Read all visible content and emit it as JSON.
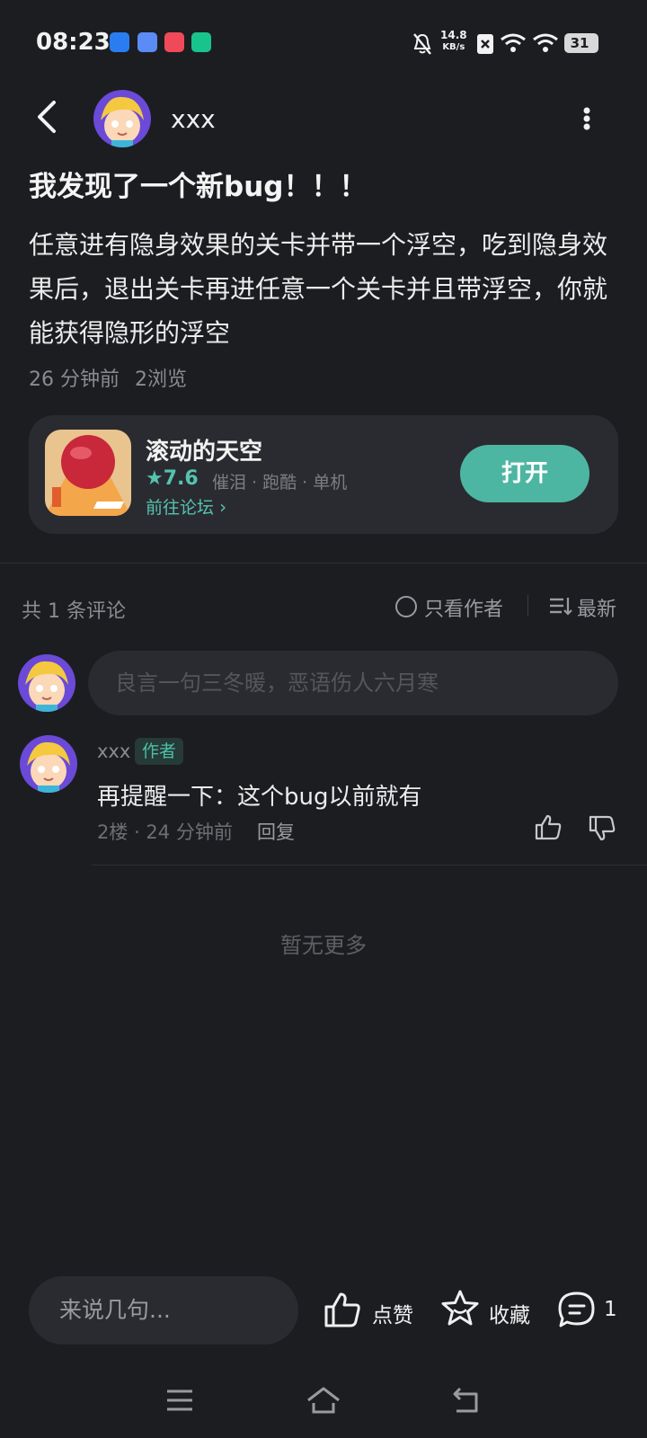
{
  "status_bar": {
    "time": "08:23",
    "speed_value": "14.8",
    "speed_unit": "KB/s",
    "battery": "31",
    "icons": [
      "mute-icon",
      "sim-off-icon",
      "wifi-icon",
      "wifi-icon",
      "battery-icon"
    ]
  },
  "header": {
    "username": "xxx"
  },
  "post": {
    "title": "我发现了一个新bug！！！",
    "body": "任意进有隐身效果的关卡并带一个浮空，吃到隐身效果后，退出关卡再进任意一个关卡并且带浮空，你就能获得隐形的浮空",
    "time": "26 分钟前",
    "views": "2浏览"
  },
  "game_card": {
    "name": "滚动的天空",
    "rating": "7.6",
    "tags": "催泪 · 跑酷 · 单机",
    "forum_link": "前往论坛",
    "open_label": "打开"
  },
  "comments_section": {
    "count_label": "共 1 条评论",
    "only_author_label": "只看作者",
    "sort_label": "最新",
    "input_placeholder": "良言一句三冬暖，恶语伤人六月寒"
  },
  "comments": [
    {
      "author": "xxx",
      "badge": "作者",
      "text": "再提醒一下：这个bug以前就有",
      "floor": "2楼",
      "time": "24 分钟前",
      "reply_label": "回复"
    }
  ],
  "end_label": "暂无更多",
  "bottom_bar": {
    "input_placeholder": "来说几句...",
    "like_label": "点赞",
    "collect_label": "收藏",
    "comment_count": "1"
  }
}
